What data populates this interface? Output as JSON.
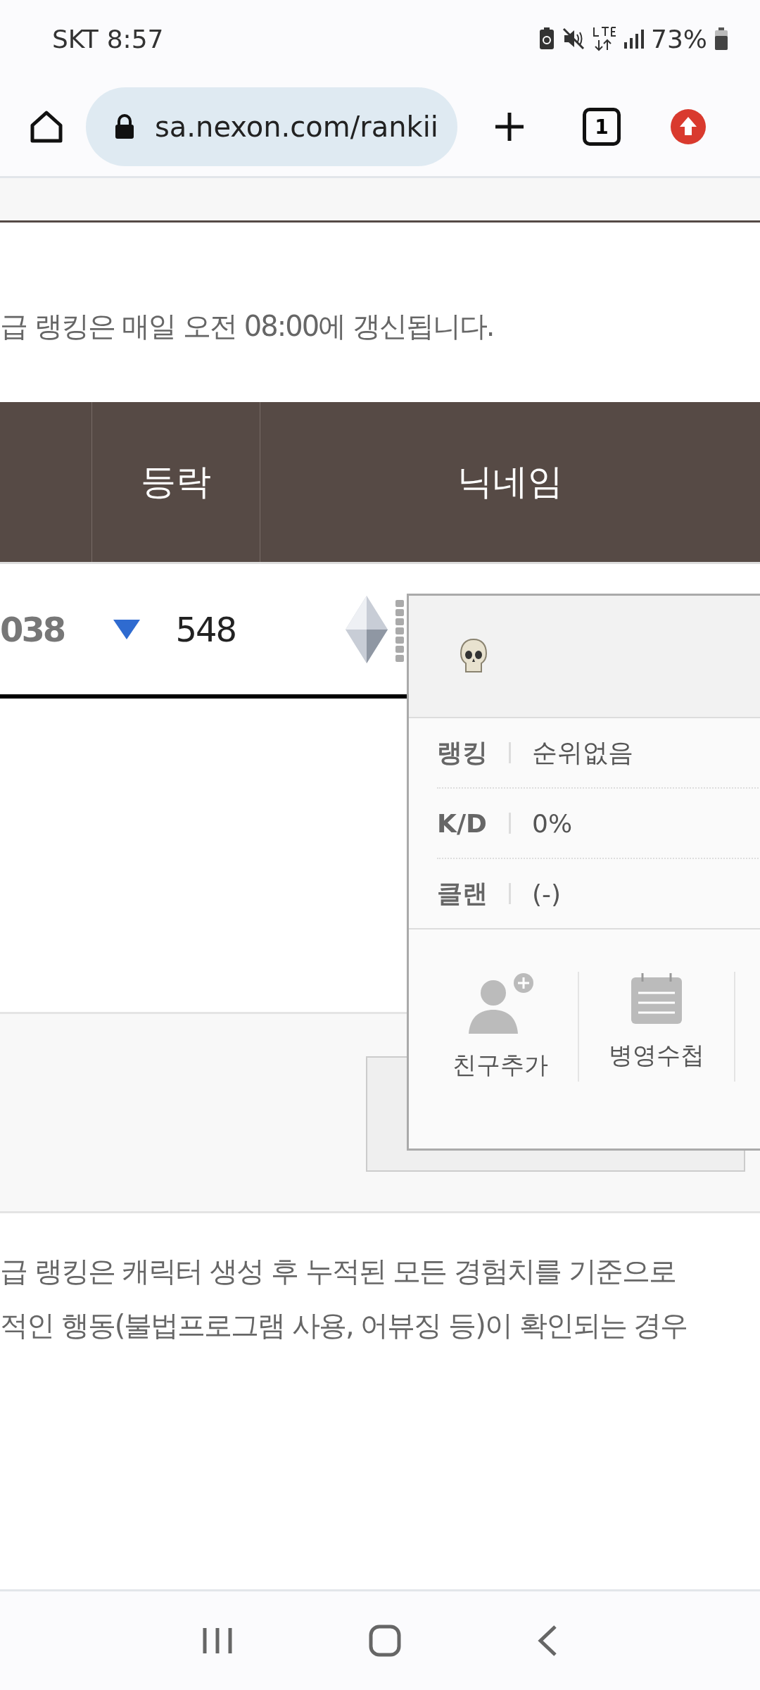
{
  "status_bar": {
    "carrier": "SKT",
    "time": "8:57",
    "battery": "73%"
  },
  "browser": {
    "url": "sa.nexon.com/rankii",
    "tab_count": "1"
  },
  "notice": "급 랭킹은 매일 오전 08:00에 갱신됩니다.",
  "table": {
    "columns": [
      "등락",
      "닉네임"
    ],
    "rows": [
      {
        "rank": "038",
        "decreased": true,
        "change_value": "548"
      }
    ]
  },
  "popup": {
    "stats": [
      {
        "label": "랭킹",
        "value": "순위없음"
      },
      {
        "label": "K/D",
        "value": "0%"
      },
      {
        "label": "클랜",
        "value": "(-)"
      }
    ],
    "actions": [
      {
        "kind": "friend",
        "label": "친구추가"
      },
      {
        "kind": "notebook",
        "label": "병영수첩"
      }
    ]
  },
  "footnotes": [
    "급 랭킹은 캐릭터 생성 후 누적된 모든 경험치를 기준으로",
    "적인 행동(불법프로그램 사용, 어뷰징 등)이 확인되는 경우"
  ]
}
